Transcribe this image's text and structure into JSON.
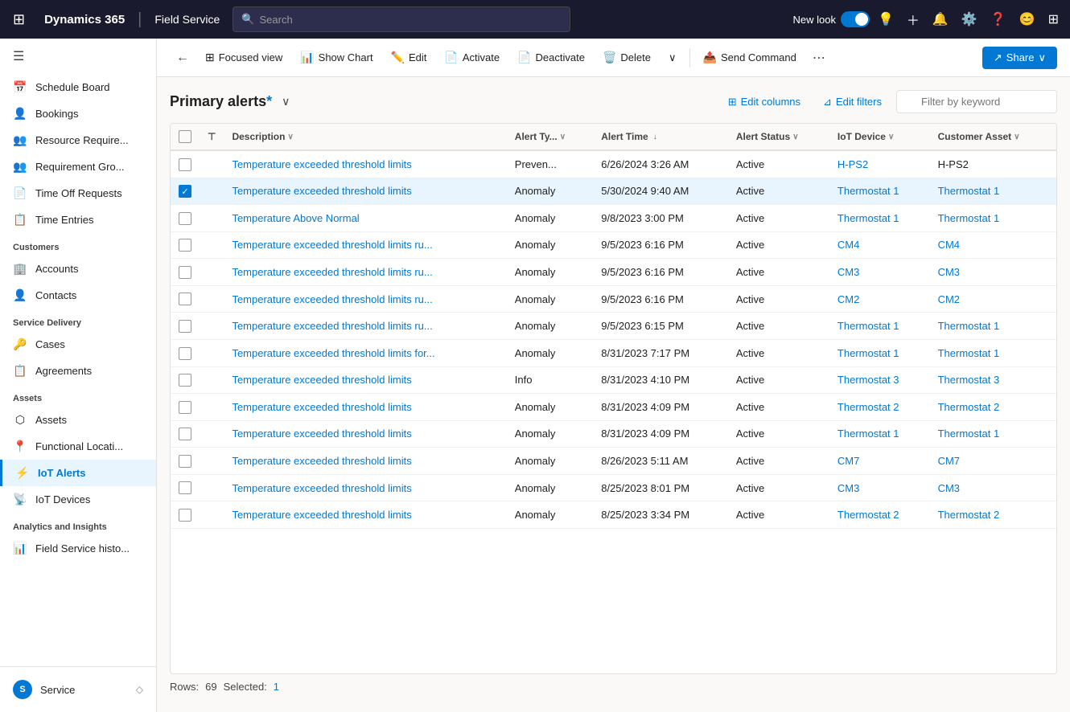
{
  "topNav": {
    "brand": "Dynamics 365",
    "app": "Field Service",
    "searchPlaceholder": "Search",
    "newLookLabel": "New look",
    "icons": [
      "lightbulb",
      "plus",
      "bell",
      "settings",
      "help",
      "user",
      "apps"
    ]
  },
  "sidebar": {
    "hamburgerIcon": "☰",
    "items": [
      {
        "id": "schedule-board",
        "label": "Schedule Board",
        "icon": "📅"
      },
      {
        "id": "bookings",
        "label": "Bookings",
        "icon": "👤"
      },
      {
        "id": "resource-require",
        "label": "Resource Require...",
        "icon": "👥"
      },
      {
        "id": "requirement-gro",
        "label": "Requirement Gro...",
        "icon": "👥"
      },
      {
        "id": "time-off-requests",
        "label": "Time Off Requests",
        "icon": "📄"
      },
      {
        "id": "time-entries",
        "label": "Time Entries",
        "icon": "📋"
      }
    ],
    "sections": [
      {
        "label": "Customers",
        "items": [
          {
            "id": "accounts",
            "label": "Accounts",
            "icon": "🏢"
          },
          {
            "id": "contacts",
            "label": "Contacts",
            "icon": "👤"
          }
        ]
      },
      {
        "label": "Service Delivery",
        "items": [
          {
            "id": "cases",
            "label": "Cases",
            "icon": "🔑"
          },
          {
            "id": "agreements",
            "label": "Agreements",
            "icon": "📋"
          }
        ]
      },
      {
        "label": "Assets",
        "items": [
          {
            "id": "assets",
            "label": "Assets",
            "icon": "⬡"
          },
          {
            "id": "functional-locati",
            "label": "Functional Locati...",
            "icon": "📍"
          },
          {
            "id": "iot-alerts",
            "label": "IoT Alerts",
            "icon": "⚡"
          },
          {
            "id": "iot-devices",
            "label": "IoT Devices",
            "icon": "📡"
          }
        ]
      },
      {
        "label": "Analytics and Insights",
        "items": [
          {
            "id": "field-service-histo",
            "label": "Field Service histo...",
            "icon": "📊"
          }
        ]
      }
    ],
    "bottomItem": {
      "id": "service",
      "label": "Service",
      "icon": "S",
      "pinIcon": "◇"
    }
  },
  "toolbar": {
    "backIcon": "←",
    "focusedViewIcon": "⊞",
    "focusedViewLabel": "Focused view",
    "showChartIcon": "📊",
    "showChartLabel": "Show Chart",
    "editIcon": "✏️",
    "editLabel": "Edit",
    "activateIcon": "📄",
    "activateLabel": "Activate",
    "deactivateIcon": "📄",
    "deactivateLabel": "Deactivate",
    "deleteIcon": "🗑️",
    "deleteLabel": "Delete",
    "chevronIcon": "∨",
    "sendCommandIcon": "📤",
    "sendCommandLabel": "Send Command",
    "moreIcon": "⋯",
    "shareIcon": "↗",
    "shareLabel": "Share",
    "shareChevron": "∨"
  },
  "grid": {
    "title": "Primary alerts",
    "titleSuffix": "*",
    "dropdownIcon": "∨",
    "editColumnsIcon": "⊞",
    "editColumnsLabel": "Edit columns",
    "editFiltersIcon": "⊿",
    "editFiltersLabel": "Edit filters",
    "filterPlaceholder": "Filter by keyword",
    "columns": [
      {
        "id": "check",
        "label": ""
      },
      {
        "id": "tree",
        "label": ""
      },
      {
        "id": "description",
        "label": "Description",
        "sortIcon": "∨"
      },
      {
        "id": "alert-type",
        "label": "Alert Ty...",
        "sortIcon": "∨"
      },
      {
        "id": "alert-time",
        "label": "Alert Time",
        "sortIcon": "↓",
        "sortActive": true
      },
      {
        "id": "alert-status",
        "label": "Alert Status",
        "sortIcon": "∨"
      },
      {
        "id": "iot-device",
        "label": "IoT Device",
        "sortIcon": "∨"
      },
      {
        "id": "customer-asset",
        "label": "Customer Asset",
        "sortIcon": "∨"
      }
    ],
    "rows": [
      {
        "id": 1,
        "checked": false,
        "selected": false,
        "description": "Temperature exceeded threshold limits",
        "alertType": "Preven...",
        "alertTime": "6/26/2024 3:26 AM",
        "alertStatus": "Active",
        "iotDevice": "H-PS2",
        "iotDeviceLink": true,
        "customerAsset": "H-PS2",
        "customerAssetLink": false
      },
      {
        "id": 2,
        "checked": true,
        "selected": true,
        "description": "Temperature exceeded threshold limits",
        "alertType": "Anomaly",
        "alertTime": "5/30/2024 9:40 AM",
        "alertStatus": "Active",
        "iotDevice": "Thermostat 1",
        "iotDeviceLink": true,
        "customerAsset": "Thermostat 1",
        "customerAssetLink": true
      },
      {
        "id": 3,
        "checked": false,
        "selected": false,
        "description": "Temperature Above Normal",
        "alertType": "Anomaly",
        "alertTime": "9/8/2023 3:00 PM",
        "alertStatus": "Active",
        "iotDevice": "Thermostat 1",
        "iotDeviceLink": true,
        "customerAsset": "Thermostat 1",
        "customerAssetLink": true
      },
      {
        "id": 4,
        "checked": false,
        "selected": false,
        "description": "Temperature exceeded threshold limits ru...",
        "alertType": "Anomaly",
        "alertTime": "9/5/2023 6:16 PM",
        "alertStatus": "Active",
        "iotDevice": "CM4",
        "iotDeviceLink": true,
        "customerAsset": "CM4",
        "customerAssetLink": true
      },
      {
        "id": 5,
        "checked": false,
        "selected": false,
        "description": "Temperature exceeded threshold limits ru...",
        "alertType": "Anomaly",
        "alertTime": "9/5/2023 6:16 PM",
        "alertStatus": "Active",
        "iotDevice": "CM3",
        "iotDeviceLink": true,
        "customerAsset": "CM3",
        "customerAssetLink": true
      },
      {
        "id": 6,
        "checked": false,
        "selected": false,
        "description": "Temperature exceeded threshold limits ru...",
        "alertType": "Anomaly",
        "alertTime": "9/5/2023 6:16 PM",
        "alertStatus": "Active",
        "iotDevice": "CM2",
        "iotDeviceLink": true,
        "customerAsset": "CM2",
        "customerAssetLink": true
      },
      {
        "id": 7,
        "checked": false,
        "selected": false,
        "description": "Temperature exceeded threshold limits ru...",
        "alertType": "Anomaly",
        "alertTime": "9/5/2023 6:15 PM",
        "alertStatus": "Active",
        "iotDevice": "Thermostat 1",
        "iotDeviceLink": true,
        "customerAsset": "Thermostat 1",
        "customerAssetLink": true
      },
      {
        "id": 8,
        "checked": false,
        "selected": false,
        "description": "Temperature exceeded threshold limits for...",
        "alertType": "Anomaly",
        "alertTime": "8/31/2023 7:17 PM",
        "alertStatus": "Active",
        "iotDevice": "Thermostat 1",
        "iotDeviceLink": true,
        "customerAsset": "Thermostat 1",
        "customerAssetLink": true
      },
      {
        "id": 9,
        "checked": false,
        "selected": false,
        "description": "Temperature exceeded threshold limits",
        "alertType": "Info",
        "alertTime": "8/31/2023 4:10 PM",
        "alertStatus": "Active",
        "iotDevice": "Thermostat 3",
        "iotDeviceLink": true,
        "customerAsset": "Thermostat 3",
        "customerAssetLink": true
      },
      {
        "id": 10,
        "checked": false,
        "selected": false,
        "description": "Temperature exceeded threshold limits",
        "alertType": "Anomaly",
        "alertTime": "8/31/2023 4:09 PM",
        "alertStatus": "Active",
        "iotDevice": "Thermostat 2",
        "iotDeviceLink": true,
        "customerAsset": "Thermostat 2",
        "customerAssetLink": true
      },
      {
        "id": 11,
        "checked": false,
        "selected": false,
        "description": "Temperature exceeded threshold limits",
        "alertType": "Anomaly",
        "alertTime": "8/31/2023 4:09 PM",
        "alertStatus": "Active",
        "iotDevice": "Thermostat 1",
        "iotDeviceLink": true,
        "customerAsset": "Thermostat 1",
        "customerAssetLink": true
      },
      {
        "id": 12,
        "checked": false,
        "selected": false,
        "description": "Temperature exceeded threshold limits",
        "alertType": "Anomaly",
        "alertTime": "8/26/2023 5:11 AM",
        "alertStatus": "Active",
        "iotDevice": "CM7",
        "iotDeviceLink": true,
        "customerAsset": "CM7",
        "customerAssetLink": true
      },
      {
        "id": 13,
        "checked": false,
        "selected": false,
        "description": "Temperature exceeded threshold limits",
        "alertType": "Anomaly",
        "alertTime": "8/25/2023 8:01 PM",
        "alertStatus": "Active",
        "iotDevice": "CM3",
        "iotDeviceLink": true,
        "customerAsset": "CM3",
        "customerAssetLink": true
      },
      {
        "id": 14,
        "checked": false,
        "selected": false,
        "description": "Temperature exceeded threshold limits",
        "alertType": "Anomaly",
        "alertTime": "8/25/2023 3:34 PM",
        "alertStatus": "Active",
        "iotDevice": "Thermostat 2",
        "iotDeviceLink": true,
        "customerAsset": "Thermostat 2",
        "customerAssetLink": true
      }
    ],
    "footer": {
      "rowsLabel": "Rows:",
      "rowsCount": "69",
      "selectedLabel": "Selected:",
      "selectedCount": "1"
    }
  }
}
